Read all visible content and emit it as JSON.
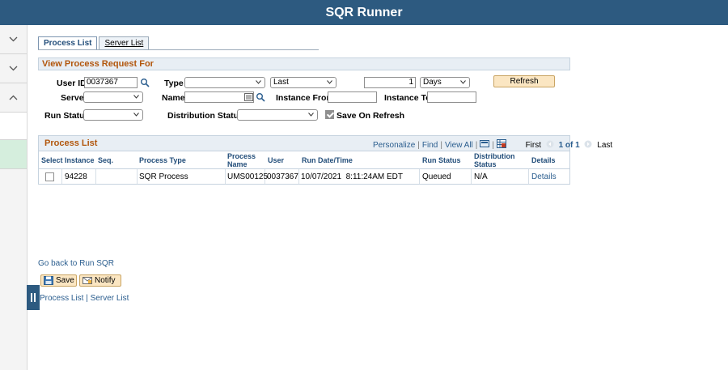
{
  "app": {
    "title": "SQR Runner"
  },
  "tabs": [
    {
      "label": "Process List"
    },
    {
      "label": "Server List"
    }
  ],
  "request": {
    "header": "View Process Request For",
    "user_id_label": "User ID",
    "user_id_value": "0037367",
    "type_label": "Type",
    "type_value": "",
    "last_value": "Last",
    "last_count": "1",
    "unit_value": "Days",
    "refresh_label": "Refresh",
    "server_label": "Server",
    "server_value": "",
    "name_label": "Name",
    "name_value": "",
    "instance_from_label": "Instance From",
    "instance_from_value": "",
    "instance_to_label": "Instance To",
    "instance_to_value": "",
    "run_status_label": "Run Status",
    "run_status_value": "",
    "distribution_status_label": "Distribution Status",
    "distribution_status_value": "",
    "save_on_refresh_label": "Save On Refresh",
    "save_on_refresh_checked": true
  },
  "process_list": {
    "title": "Process List",
    "personalize": "Personalize",
    "find": "Find",
    "view_all": "View All",
    "first": "First",
    "count": "1 of 1",
    "last": "Last",
    "columns": {
      "select": "Select",
      "instance": "Instance",
      "seq": "Seq.",
      "process_type": "Process Type",
      "process_name": "Process Name",
      "user": "User",
      "run_datetime": "Run Date/Time",
      "run_status": "Run Status",
      "distribution_status": "Distribution Status",
      "details": "Details"
    },
    "rows": [
      {
        "instance": "94228",
        "seq": "",
        "process_type": "SQR Process",
        "process_name": "UMS00125",
        "user": "0037367",
        "run_datetime": "10/07/2021  8:11:24AM EDT",
        "run_status": "Queued",
        "distribution_status": "N/A",
        "details": "Details"
      }
    ]
  },
  "footer": {
    "go_back": "Go back to Run SQR",
    "save": "Save",
    "notify": "Notify",
    "link_process_list": "Process List",
    "link_separator": "|",
    "link_server_list": "Server List"
  },
  "colors": {
    "header_bar": "#2d5a80",
    "section_title": "#b2560c",
    "link": "#2a5d8e",
    "button": "#fbe6c2"
  }
}
